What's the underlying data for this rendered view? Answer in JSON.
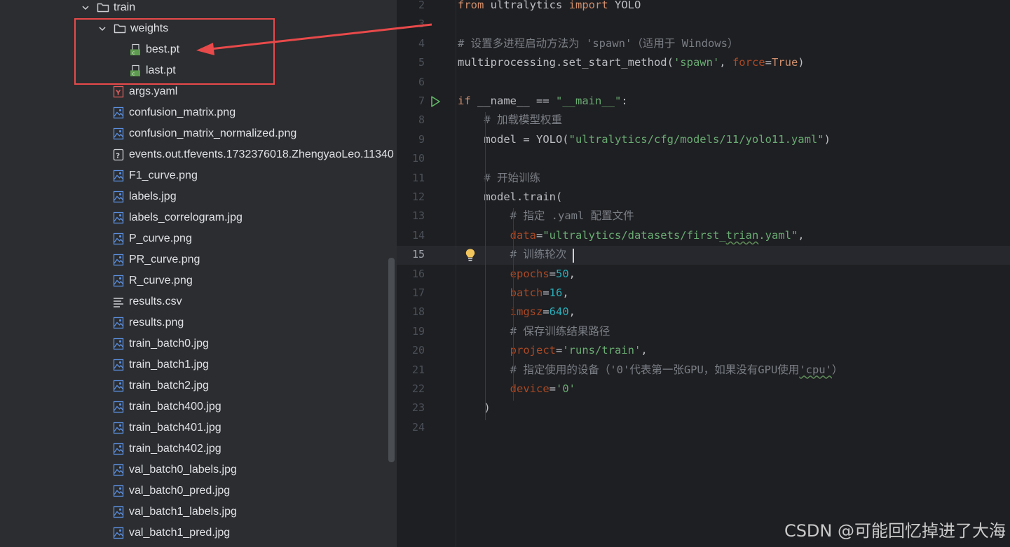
{
  "project_tree": {
    "items": [
      {
        "label": "train",
        "icon": "folder-icon",
        "expanded": true
      },
      {
        "label": "weights",
        "icon": "folder-icon",
        "expanded": true
      },
      {
        "label": "best.pt",
        "icon": "pytorch-file-icon"
      },
      {
        "label": "last.pt",
        "icon": "pytorch-file-icon"
      },
      {
        "label": "args.yaml",
        "icon": "yaml-file-icon"
      },
      {
        "label": "confusion_matrix.png",
        "icon": "image-file-icon"
      },
      {
        "label": "confusion_matrix_normalized.png",
        "icon": "image-file-icon"
      },
      {
        "label": "events.out.tfevents.1732376018.ZhengyaoLeo.11340",
        "icon": "unknown-file-icon"
      },
      {
        "label": "F1_curve.png",
        "icon": "image-file-icon"
      },
      {
        "label": "labels.jpg",
        "icon": "image-file-icon"
      },
      {
        "label": "labels_correlogram.jpg",
        "icon": "image-file-icon"
      },
      {
        "label": "P_curve.png",
        "icon": "image-file-icon"
      },
      {
        "label": "PR_curve.png",
        "icon": "image-file-icon"
      },
      {
        "label": "R_curve.png",
        "icon": "image-file-icon"
      },
      {
        "label": "results.csv",
        "icon": "text-file-icon"
      },
      {
        "label": "results.png",
        "icon": "image-file-icon"
      },
      {
        "label": "train_batch0.jpg",
        "icon": "image-file-icon"
      },
      {
        "label": "train_batch1.jpg",
        "icon": "image-file-icon"
      },
      {
        "label": "train_batch2.jpg",
        "icon": "image-file-icon"
      },
      {
        "label": "train_batch400.jpg",
        "icon": "image-file-icon"
      },
      {
        "label": "train_batch401.jpg",
        "icon": "image-file-icon"
      },
      {
        "label": "train_batch402.jpg",
        "icon": "image-file-icon"
      },
      {
        "label": "val_batch0_labels.jpg",
        "icon": "image-file-icon"
      },
      {
        "label": "val_batch0_pred.jpg",
        "icon": "image-file-icon"
      },
      {
        "label": "val_batch1_labels.jpg",
        "icon": "image-file-icon"
      },
      {
        "label": "val_batch1_pred.jpg",
        "icon": "image-file-icon"
      }
    ]
  },
  "editor": {
    "current_line": "15",
    "lines": [
      {
        "number": "2",
        "tokens": [
          [
            "kw",
            "from"
          ],
          [
            "",
            " ultralytics "
          ],
          [
            "kw",
            "import"
          ],
          [
            "",
            " YOLO"
          ]
        ]
      },
      {
        "number": "3",
        "tokens": []
      },
      {
        "number": "4",
        "tokens": [
          [
            "cm",
            "# 设置多进程启动方法为 'spawn'（适用于 Windows）"
          ]
        ]
      },
      {
        "number": "5",
        "tokens": [
          [
            "",
            "multiprocessing.set_start_method("
          ],
          [
            "st",
            "'spawn'"
          ],
          [
            "",
            ", "
          ],
          [
            "kwa",
            "force"
          ],
          [
            "",
            "="
          ],
          [
            "kw",
            "True"
          ],
          [
            "",
            ")"
          ]
        ]
      },
      {
        "number": "6",
        "tokens": []
      },
      {
        "number": "7",
        "tokens": [
          [
            "kw",
            "if"
          ],
          [
            "",
            " __name__ == "
          ],
          [
            "st",
            "\"__main__\""
          ],
          [
            "",
            ":"
          ]
        ]
      },
      {
        "number": "8",
        "tokens": [
          [
            "cm",
            "    # 加载模型权重"
          ]
        ]
      },
      {
        "number": "9",
        "tokens": [
          [
            "",
            "    model = YOLO("
          ],
          [
            "st",
            "\"ultralytics/cfg/models/11/yolo11.yaml\""
          ],
          [
            "",
            ")"
          ]
        ]
      },
      {
        "number": "10",
        "tokens": []
      },
      {
        "number": "11",
        "tokens": [
          [
            "cm",
            "    # 开始训练"
          ]
        ]
      },
      {
        "number": "12",
        "tokens": [
          [
            "",
            "    model.train("
          ]
        ]
      },
      {
        "number": "13",
        "tokens": [
          [
            "cm",
            "        # 指定 .yaml 配置文件"
          ]
        ]
      },
      {
        "number": "14",
        "tokens": [
          [
            "",
            "        "
          ],
          [
            "kwa",
            "data"
          ],
          [
            "",
            "="
          ],
          [
            "st",
            "\"ultralytics/datasets/first_"
          ],
          [
            "st typo",
            "trian"
          ],
          [
            "st",
            ".yaml\""
          ],
          [
            "",
            ","
          ]
        ]
      },
      {
        "number": "15",
        "tokens": [
          [
            "cm",
            "        # 训练轮次"
          ]
        ]
      },
      {
        "number": "16",
        "tokens": [
          [
            "",
            "        "
          ],
          [
            "kwa",
            "epochs"
          ],
          [
            "",
            "="
          ],
          [
            "num",
            "50"
          ],
          [
            "",
            ","
          ]
        ]
      },
      {
        "number": "17",
        "tokens": [
          [
            "",
            "        "
          ],
          [
            "kwa",
            "batch"
          ],
          [
            "",
            "="
          ],
          [
            "num",
            "16"
          ],
          [
            "",
            ","
          ]
        ]
      },
      {
        "number": "18",
        "tokens": [
          [
            "",
            "        "
          ],
          [
            "kwa",
            "imgsz"
          ],
          [
            "",
            "="
          ],
          [
            "num",
            "640"
          ],
          [
            "",
            ","
          ]
        ]
      },
      {
        "number": "19",
        "tokens": [
          [
            "cm",
            "        # 保存训练结果路径"
          ]
        ]
      },
      {
        "number": "20",
        "tokens": [
          [
            "",
            "        "
          ],
          [
            "kwa",
            "project"
          ],
          [
            "",
            "="
          ],
          [
            "st",
            "'runs/train'"
          ],
          [
            "",
            ","
          ]
        ]
      },
      {
        "number": "21",
        "tokens": [
          [
            "cm",
            "        # 指定使用的设备（'0'代表第一张GPU，如果没有GPU使用"
          ],
          [
            "cm typo",
            "'cpu'"
          ],
          [
            "cm",
            "）"
          ]
        ]
      },
      {
        "number": "22",
        "tokens": [
          [
            "",
            "        "
          ],
          [
            "kwa",
            "device"
          ],
          [
            "",
            "="
          ],
          [
            "st",
            "'0'"
          ]
        ]
      },
      {
        "number": "23",
        "tokens": [
          [
            "",
            "    )"
          ]
        ]
      },
      {
        "number": "24",
        "tokens": []
      }
    ]
  },
  "watermark": "CSDN @可能回忆掉进了大海",
  "colors": {
    "highlight_border": "#e8494a",
    "keyword": "#cf8e6d",
    "string": "#6aab73",
    "comment": "#7a7e85",
    "number": "#2aacb8",
    "named_arg": "#aa4926"
  }
}
